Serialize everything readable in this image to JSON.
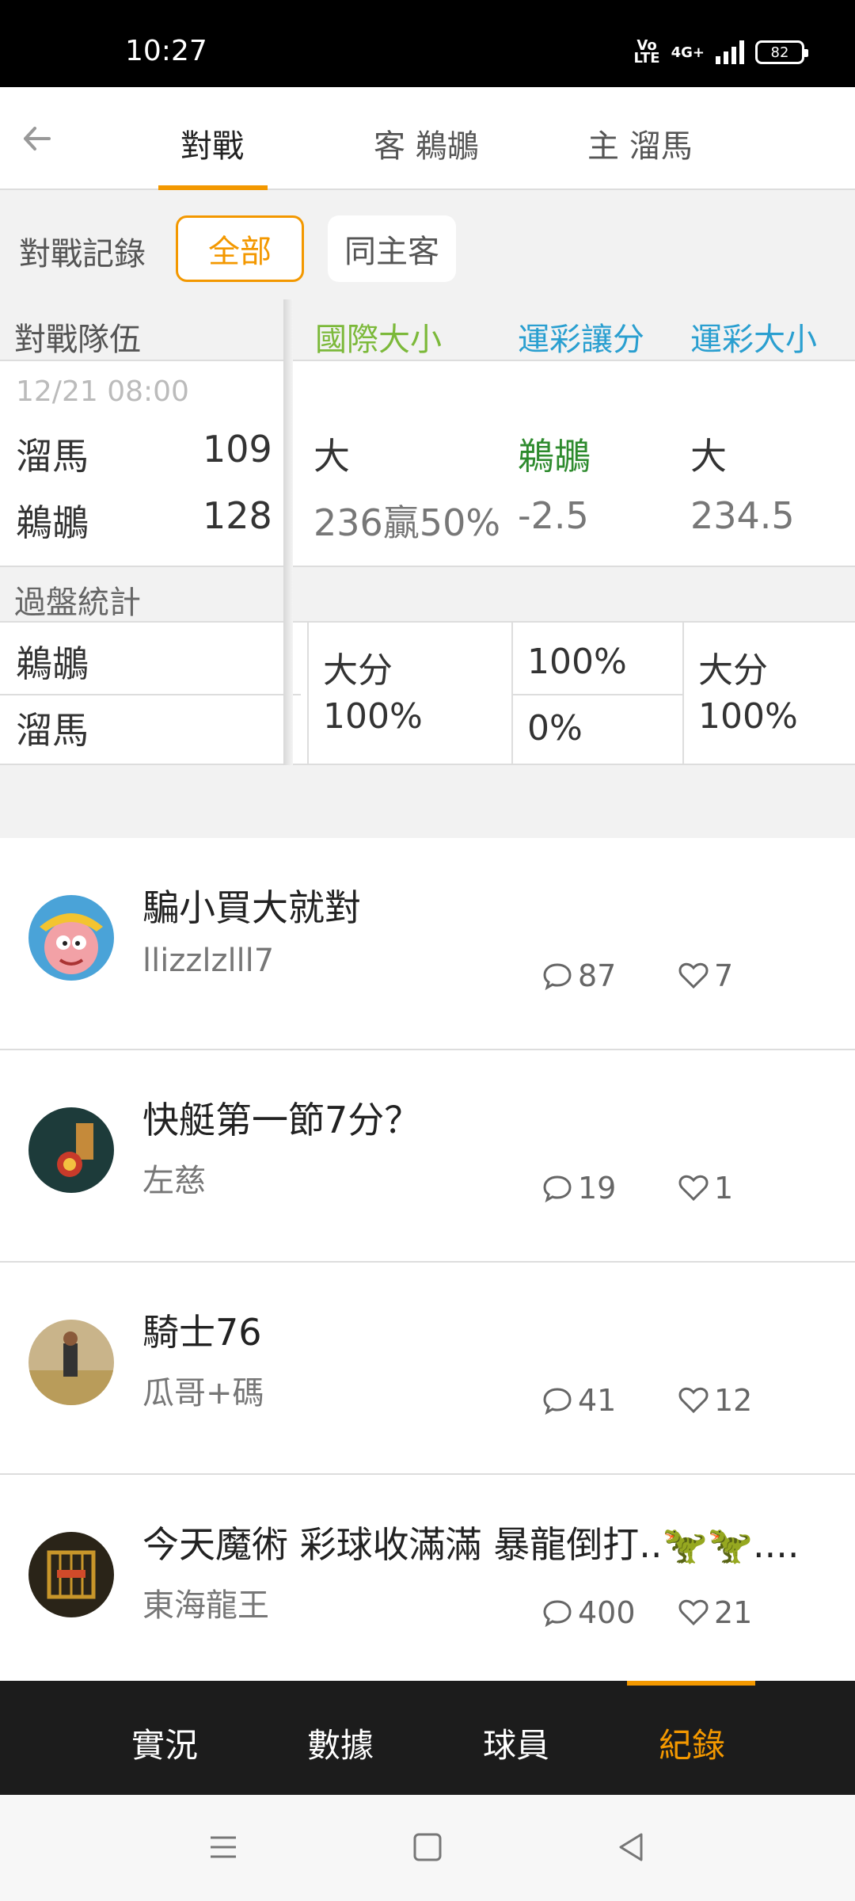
{
  "status_bar": {
    "time": "10:27",
    "volte": "Vo\nLTE",
    "network": "4G+",
    "battery": "82"
  },
  "top_tabs": [
    {
      "label": "對戰",
      "active": true
    },
    {
      "label": "客 鵜鶘",
      "active": false
    },
    {
      "label": "主 溜馬",
      "active": false
    }
  ],
  "filter": {
    "label": "對戰記錄",
    "options": [
      "全部",
      "同主客"
    ],
    "selected": "全部"
  },
  "table": {
    "header": {
      "teams": "對戰隊伍",
      "col1": "國際大小",
      "col2": "運彩讓分",
      "col3": "運彩大小"
    },
    "game": {
      "date": "12/21 08:00",
      "team1": {
        "name": "溜馬",
        "score": "109"
      },
      "team2": {
        "name": "鵜鶘",
        "score": "128"
      },
      "col1_top": "大",
      "col1_bottom": "236贏50%",
      "col2_top": "鵜鶘",
      "col2_bottom": "-2.5",
      "col3_top": "大",
      "col3_bottom": "234.5"
    },
    "stats": {
      "label": "過盤統計",
      "team1": "鵜鶘",
      "team2": "溜馬",
      "col1_line1": "大分",
      "col1_line2": "100%",
      "col2_top": "100%",
      "col2_bottom": "0%",
      "col3_line1": "大分",
      "col3_line2": "100%"
    }
  },
  "posts": [
    {
      "title": "騙小買大就對",
      "author": "llizzlzlll7",
      "comments": "87",
      "likes": "7"
    },
    {
      "title": "快艇第一節7分？",
      "author": "左慈",
      "comments": "19",
      "likes": "1"
    },
    {
      "title": "騎士76",
      "author": "瓜哥+碼",
      "comments": "41",
      "likes": "12"
    },
    {
      "title": "今天魔術 彩球收滿滿 暴龍倒打..🦖🦖....",
      "author": "東海龍王",
      "comments": "400",
      "likes": "21"
    }
  ],
  "bottom_nav": [
    {
      "label": "實況"
    },
    {
      "label": "數據"
    },
    {
      "label": "球員"
    },
    {
      "label": "紀錄",
      "active": true
    }
  ],
  "colors": {
    "accent": "#f39800",
    "green": "#7cb93a",
    "blue": "#2a9fd0",
    "team_green": "#2e8b2e"
  }
}
